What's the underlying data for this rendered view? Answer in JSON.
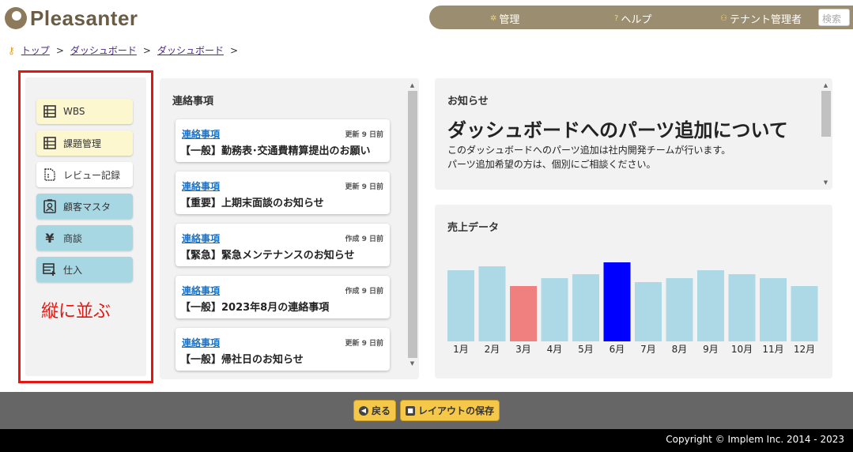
{
  "header": {
    "logo_text": "Pleasanter",
    "nav": [
      {
        "label": "管理",
        "icon": "gear-icon"
      },
      {
        "label": "ヘルプ",
        "icon": "question-icon"
      },
      {
        "label": "テナント管理者",
        "icon": "user-icon"
      }
    ],
    "search_placeholder": "検索"
  },
  "breadcrumb": [
    "トップ",
    "ダッシュボード",
    "ダッシュボード"
  ],
  "left_menu": {
    "items": [
      {
        "label": "WBS",
        "icon": "table-icon",
        "color": "#fdf7cf"
      },
      {
        "label": "課題管理",
        "icon": "table-icon",
        "color": "#fdf7cf"
      },
      {
        "label": "レビュー記録",
        "icon": "document-icon",
        "color": "#ffffff"
      },
      {
        "label": "顧客マスタ",
        "icon": "contact-card-icon",
        "color": "#a8d7e4"
      },
      {
        "label": "商談",
        "icon": "yen-icon",
        "color": "#a8d7e4"
      },
      {
        "label": "仕入",
        "icon": "table-add-icon",
        "color": "#a8d7e4"
      }
    ],
    "annotation": "縦に並ぶ",
    "annotation_color": "#e8140f"
  },
  "notices": {
    "title": "連絡事項",
    "items": [
      {
        "link": "連絡事項",
        "meta": "更新 9 日前",
        "title": "【一般】勤務表･交通費精算提出のお願い"
      },
      {
        "link": "連絡事項",
        "meta": "更新 9 日前",
        "title": "【重要】上期末面談のお知らせ"
      },
      {
        "link": "連絡事項",
        "meta": "作成 9 日前",
        "title": "【緊急】緊急メンテナンスのお知らせ"
      },
      {
        "link": "連絡事項",
        "meta": "作成 9 日前",
        "title": "【一般】2023年8月の連絡事項"
      },
      {
        "link": "連絡事項",
        "meta": "更新 9 日前",
        "title": "【一般】帰社日のお知らせ"
      }
    ]
  },
  "info": {
    "heading": "お知らせ",
    "title": "ダッシュボードへのパーツ追加について",
    "line1": "このダッシュボードへのパーツ追加は社内開発チームが行います。",
    "line2": "パーツ追加希望の方は、個別にご相談ください。"
  },
  "sales": {
    "title": "売上データ"
  },
  "chart_data": {
    "type": "bar",
    "title": "売上データ",
    "categories": [
      "1月",
      "2月",
      "3月",
      "4月",
      "5月",
      "6月",
      "7月",
      "8月",
      "9月",
      "10月",
      "11月",
      "12月"
    ],
    "values": [
      90,
      95,
      70,
      80,
      85,
      100,
      75,
      80,
      90,
      85,
      80,
      70
    ],
    "colors": [
      "#add8e6",
      "#add8e6",
      "#f08080",
      "#add8e6",
      "#add8e6",
      "#0000ff",
      "#add8e6",
      "#add8e6",
      "#add8e6",
      "#add8e6",
      "#add8e6",
      "#add8e6"
    ],
    "xlabel": "",
    "ylabel": "",
    "ylim": [
      0,
      100
    ],
    "grid": false,
    "legend": false
  },
  "footer": {
    "back_label": "戻る",
    "save_label": "レイアウトの保存",
    "copyright": "Copyright © Implem Inc. 2014 - 2023"
  }
}
